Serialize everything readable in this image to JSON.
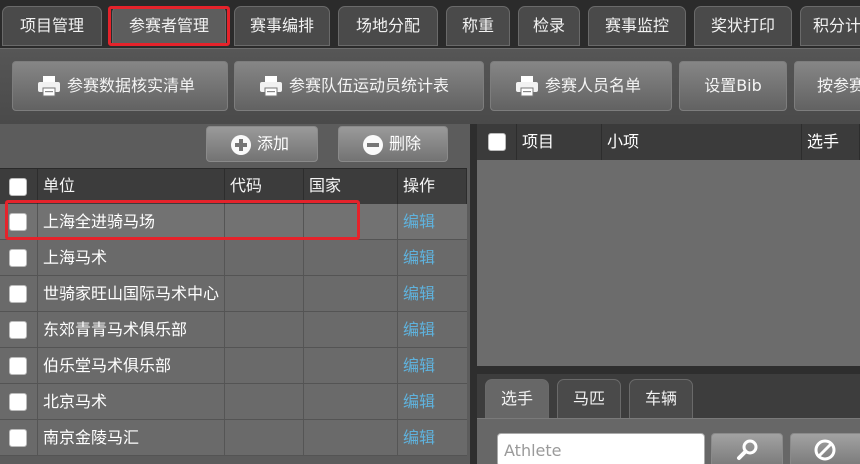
{
  "top_tabs": [
    {
      "label": "项目管理"
    },
    {
      "label": "参赛者管理"
    },
    {
      "label": "赛事编排"
    },
    {
      "label": "场地分配"
    },
    {
      "label": "称重"
    },
    {
      "label": "检录"
    },
    {
      "label": "赛事监控"
    },
    {
      "label": "奖状打印"
    },
    {
      "label": "积分计"
    }
  ],
  "toolbar": {
    "buttons": [
      {
        "label": "参赛数据核实清单",
        "icon": "printer-icon"
      },
      {
        "label": "参赛队伍运动员统计表",
        "icon": "printer-icon"
      },
      {
        "label": "参赛人员名单",
        "icon": "printer-icon"
      },
      {
        "label": "设置Bib"
      },
      {
        "label": "按参赛"
      }
    ]
  },
  "units_panel": {
    "add_label": "添加",
    "delete_label": "删除",
    "columns": [
      "单位",
      "代码",
      "国家",
      "操作"
    ],
    "rows": [
      {
        "name": "上海全进骑马场",
        "code": "",
        "country": "",
        "action": "编辑"
      },
      {
        "name": "上海马术",
        "code": "",
        "country": "",
        "action": "编辑"
      },
      {
        "name": "世骑家旺山国际马术中心",
        "code": "",
        "country": "",
        "action": "编辑"
      },
      {
        "name": "东郊青青马术俱乐部",
        "code": "",
        "country": "",
        "action": "编辑"
      },
      {
        "name": "伯乐堂马术俱乐部",
        "code": "",
        "country": "",
        "action": "编辑"
      },
      {
        "name": "北京马术",
        "code": "",
        "country": "",
        "action": "编辑"
      },
      {
        "name": "南京金陵马汇",
        "code": "",
        "country": "",
        "action": "编辑"
      }
    ]
  },
  "entries_panel": {
    "columns": [
      "项目",
      "小项",
      "选手"
    ]
  },
  "sub_tabs": [
    {
      "label": "选手"
    },
    {
      "label": "马匹"
    },
    {
      "label": "车辆"
    }
  ],
  "search": {
    "placeholder": "Athlete",
    "value": ""
  },
  "colors": {
    "highlight": "#e5232b",
    "link": "#5fb2dd",
    "tabbar": "#2b2b2b"
  }
}
